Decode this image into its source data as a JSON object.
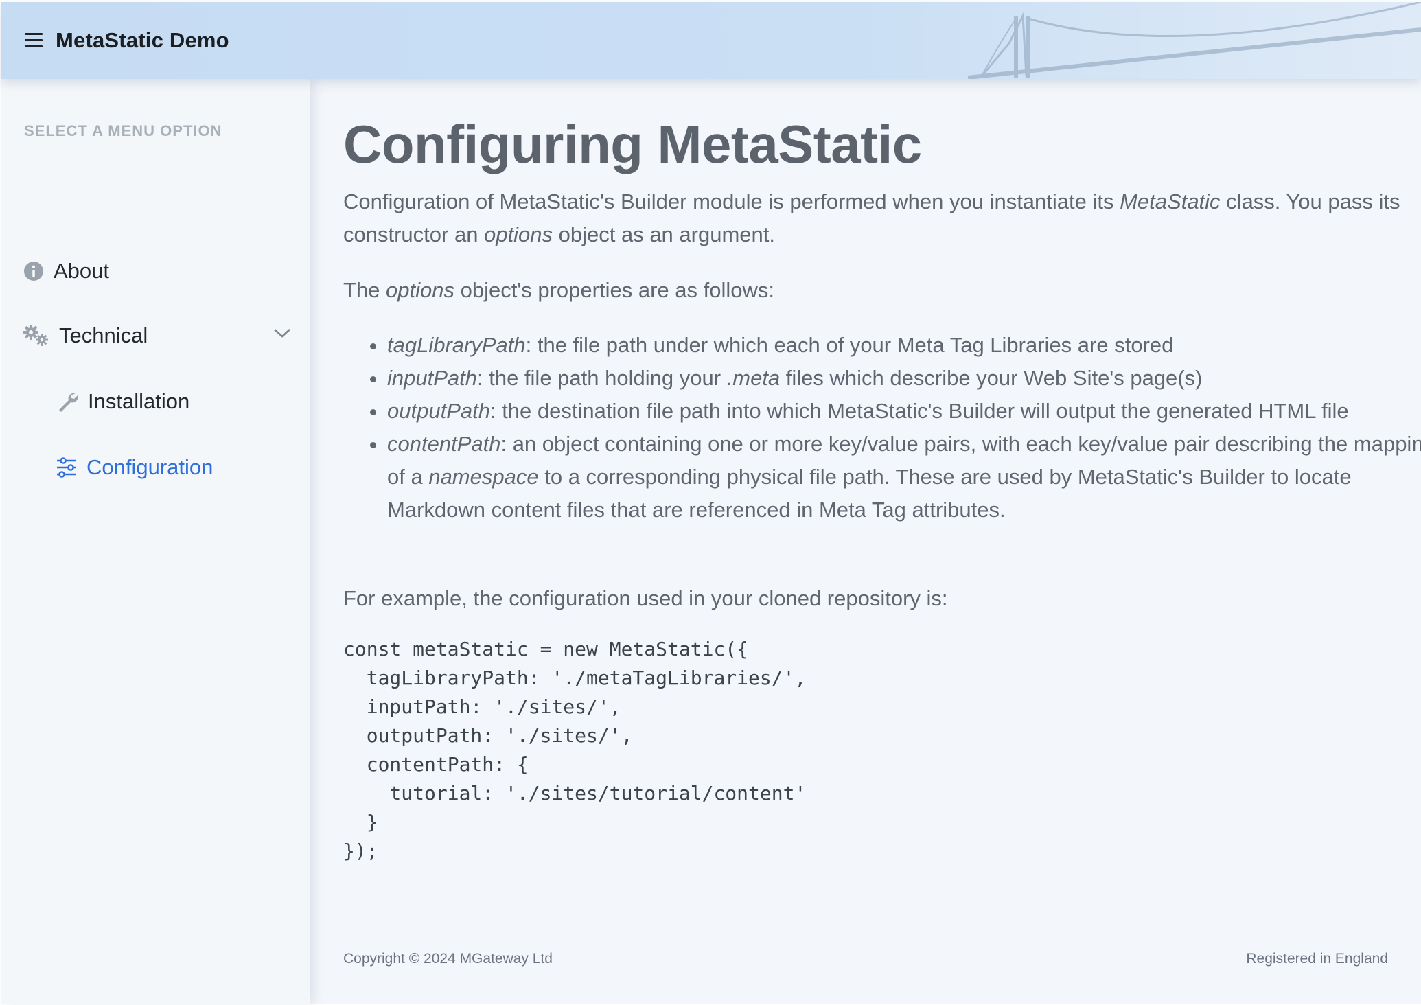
{
  "header": {
    "brand": "MetaStatic Demo",
    "menu_icon": "hamburger-icon"
  },
  "sidebar": {
    "heading": "SELECT A MENU OPTION",
    "items": [
      {
        "label": "About",
        "icon": "info-icon",
        "active": false
      },
      {
        "label": "Technical",
        "icon": "gears-icon",
        "expanded": true
      },
      {
        "label": "Installation",
        "icon": "wrench-icon",
        "active": false
      },
      {
        "label": "Configuration",
        "icon": "sliders-icon",
        "active": true
      }
    ]
  },
  "main": {
    "title": "Configuring MetaStatic",
    "p1": {
      "a": "Configuration of MetaStatic's Builder module is performed when you instantiate its ",
      "b": "MetaStatic",
      "c": " class. You pass its constructor an ",
      "d": "options",
      "e": " object as an argument."
    },
    "p2": {
      "a": "The ",
      "b": "options",
      "c": " object's properties are as follows:"
    },
    "properties": [
      {
        "name": "tagLibraryPath",
        "desc": ": the file path under which each of your Meta Tag Libraries are stored"
      },
      {
        "name": "inputPath",
        "desc_a": ": the file path holding your ",
        "desc_em": ".meta",
        "desc_b": " files which describe your Web Site's page(s)"
      },
      {
        "name": "outputPath",
        "desc": ": the destination file path into which MetaStatic's Builder will output the generated HTML file"
      },
      {
        "name": "contentPath",
        "desc_a": ": an object containing one or more key/value pairs, with each key/value pair describing the mapping of a ",
        "desc_em": "namespace",
        "desc_b": " to a corresponding physical file path. These are used by MetaStatic's Builder to locate Markdown content files that are referenced in Meta Tag attributes."
      }
    ],
    "p3": "For example, the configuration used in your cloned repository is:",
    "code": "const metaStatic = new MetaStatic({\n  tagLibraryPath: './metaTagLibraries/',\n  inputPath: './sites/',\n  outputPath: './sites/',\n  contentPath: {\n    tutorial: './sites/tutorial/content'\n  }\n});"
  },
  "footer": {
    "copyright": "Copyright © 2024 MGateway Ltd",
    "registered": "Registered in England"
  },
  "colors": {
    "header_bg": "#c6dcf3",
    "sidebar_bg": "#f4f7fa",
    "main_bg": "#f3f6fa",
    "active_link": "#2e6fdb"
  }
}
